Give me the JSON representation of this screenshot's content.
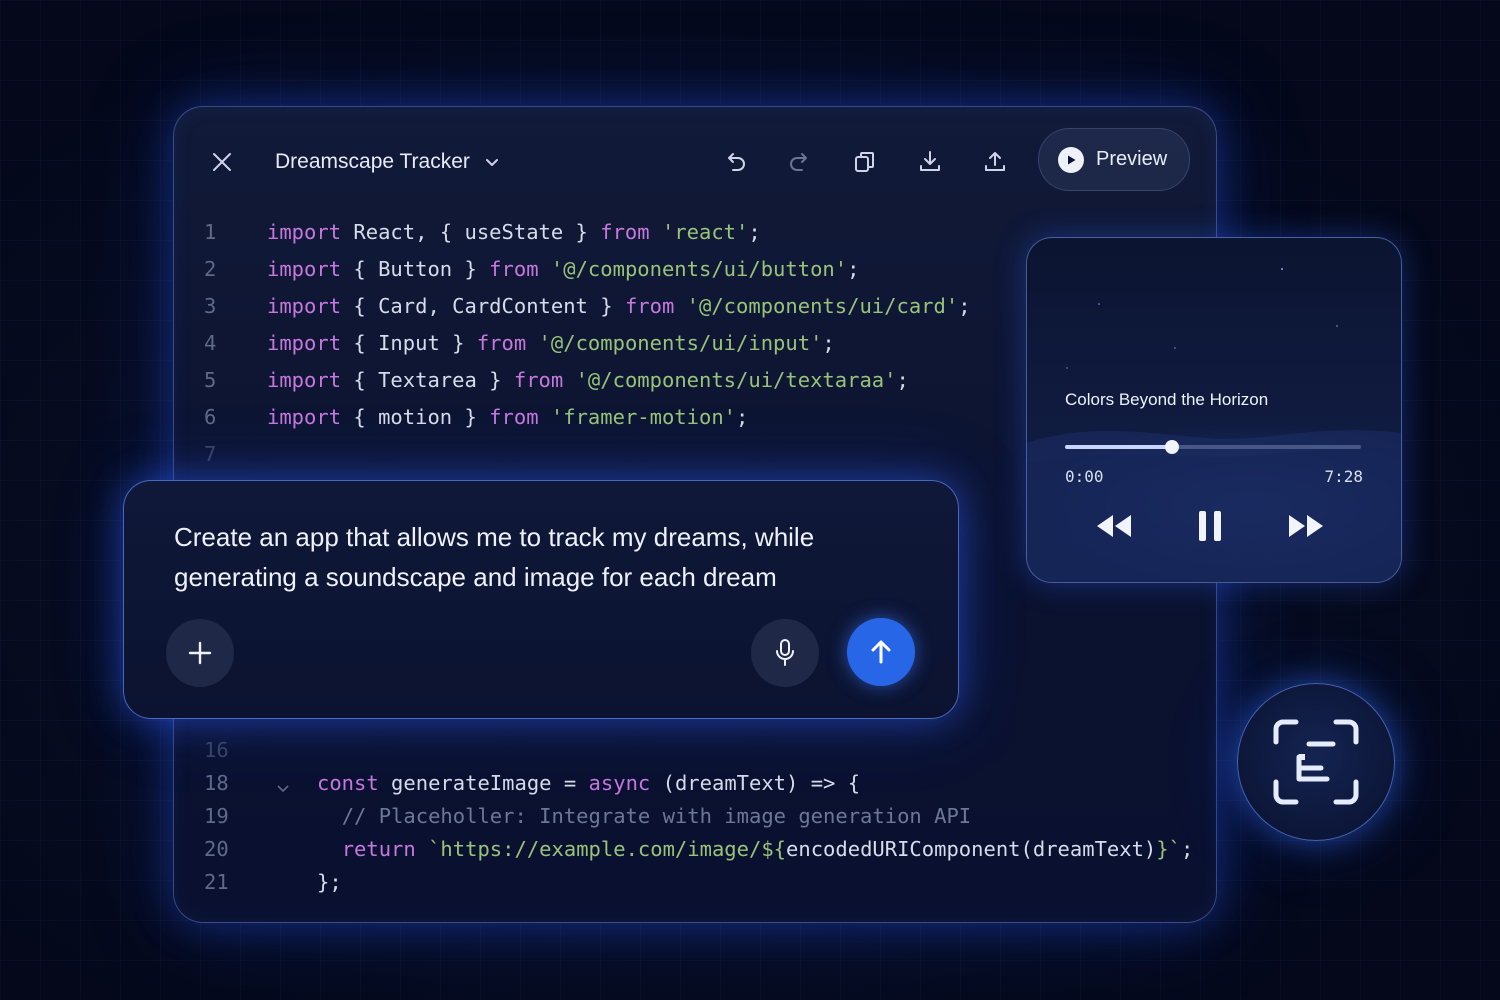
{
  "editor": {
    "title": "Dreamscape Tracker",
    "preview_label": "Preview",
    "code_top": [
      {
        "num": "1",
        "parts": [
          [
            "kw",
            "import"
          ],
          [
            "txt",
            " React, { useState } "
          ],
          [
            "kw",
            "from"
          ],
          [
            "txt",
            " "
          ],
          [
            "str",
            "'react'"
          ],
          [
            "txt",
            ";"
          ]
        ]
      },
      {
        "num": "2",
        "parts": [
          [
            "kw",
            "import"
          ],
          [
            "txt",
            " { Button } "
          ],
          [
            "kw",
            "from"
          ],
          [
            "txt",
            " "
          ],
          [
            "str",
            "'@/components/ui/button'"
          ],
          [
            "txt",
            ";"
          ]
        ]
      },
      {
        "num": "3",
        "parts": [
          [
            "kw",
            "import"
          ],
          [
            "txt",
            " { Card, CardContent } "
          ],
          [
            "kw",
            "from"
          ],
          [
            "txt",
            " "
          ],
          [
            "str",
            "'@/components/ui/card'"
          ],
          [
            "txt",
            ";"
          ]
        ]
      },
      {
        "num": "4",
        "parts": [
          [
            "kw",
            "import"
          ],
          [
            "txt",
            " { Input } "
          ],
          [
            "kw",
            "from"
          ],
          [
            "txt",
            " "
          ],
          [
            "str",
            "'@/components/ui/input'"
          ],
          [
            "txt",
            ";"
          ]
        ]
      },
      {
        "num": "5",
        "parts": [
          [
            "kw",
            "import"
          ],
          [
            "txt",
            " { Textarea } "
          ],
          [
            "kw",
            "from"
          ],
          [
            "txt",
            " "
          ],
          [
            "str",
            "'@/components/ui/textaraa'"
          ],
          [
            "txt",
            ";"
          ]
        ]
      },
      {
        "num": "6",
        "parts": [
          [
            "kw",
            "import"
          ],
          [
            "txt",
            " { motion } "
          ],
          [
            "kw",
            "from"
          ],
          [
            "txt",
            " "
          ],
          [
            "str",
            "'framer-motion'"
          ],
          [
            "txt",
            ";"
          ]
        ]
      },
      {
        "num": "7",
        "parts": []
      }
    ],
    "code_bottom": [
      {
        "num": "16",
        "parts": []
      },
      {
        "num": "18",
        "fold": true,
        "parts": [
          [
            "kw",
            "const"
          ],
          [
            "txt",
            " generateImage = "
          ],
          [
            "kw",
            "async"
          ],
          [
            "txt",
            " (dreamText) => {"
          ]
        ]
      },
      {
        "num": "19",
        "parts": [
          [
            "txt",
            "  "
          ],
          [
            "cmt",
            "// Placeholler: Integrate with image generation API"
          ]
        ]
      },
      {
        "num": "20",
        "parts": [
          [
            "txt",
            "  "
          ],
          [
            "kw",
            "return"
          ],
          [
            "txt",
            " "
          ],
          [
            "str",
            "`https://example.com/image/${"
          ],
          [
            "txt",
            "encodedURIComponent(dreamText)"
          ],
          [
            "str",
            "}`"
          ],
          [
            "txt",
            ";"
          ]
        ]
      },
      {
        "num": "21",
        "parts": [
          [
            "txt",
            "};"
          ]
        ]
      }
    ]
  },
  "prompt": {
    "text": "Create an app that allows me to track my dreams, while generating a soundscape and image for each dream"
  },
  "player": {
    "track_title": "Colors Beyond the Horizon",
    "elapsed": "0:00",
    "duration": "7:28",
    "progress": 0.36
  },
  "colors": {
    "accent": "#2866e8",
    "keyword": "#c678dd",
    "string": "#98c379",
    "comment": "#6d7896"
  },
  "icons": [
    "close-icon",
    "chevron-down-icon",
    "undo-icon",
    "redo-icon",
    "copy-icon",
    "download-icon",
    "share-icon",
    "play-icon",
    "plus-icon",
    "microphone-icon",
    "arrow-up-icon",
    "rewind-icon",
    "pause-icon",
    "fast-forward-icon",
    "scan-text-icon"
  ]
}
